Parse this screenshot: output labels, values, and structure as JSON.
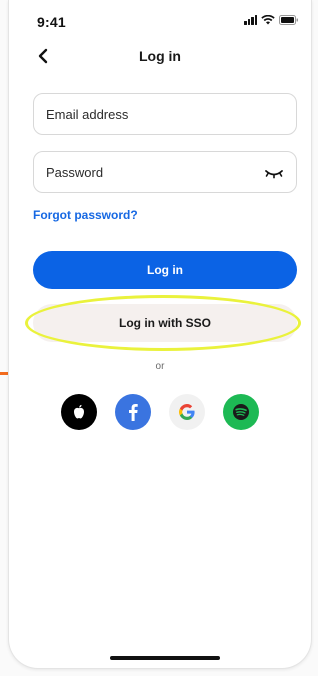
{
  "status_bar": {
    "time": "9:41"
  },
  "header": {
    "title": "Log in",
    "back_icon": "chevron-left-icon"
  },
  "form": {
    "email": {
      "placeholder": "Email address",
      "value": ""
    },
    "password": {
      "placeholder": "Password",
      "value": ""
    },
    "forgot_password_label": "Forgot password?"
  },
  "buttons": {
    "login_label": "Log in",
    "sso_label": "Log in with SSO"
  },
  "divider": {
    "or_label": "or"
  },
  "social": [
    {
      "name": "apple",
      "icon": "apple-icon",
      "color": "#000000"
    },
    {
      "name": "facebook",
      "icon": "facebook-icon",
      "color": "#3a74e0"
    },
    {
      "name": "google",
      "icon": "google-icon",
      "color": "#f1f1f1"
    },
    {
      "name": "spotify",
      "icon": "spotify-icon",
      "color": "#1db954"
    }
  ],
  "colors": {
    "primary": "#0b63e5",
    "link": "#1668e3",
    "sso_background": "#f5f0ee",
    "highlight": "#eaf23c"
  }
}
